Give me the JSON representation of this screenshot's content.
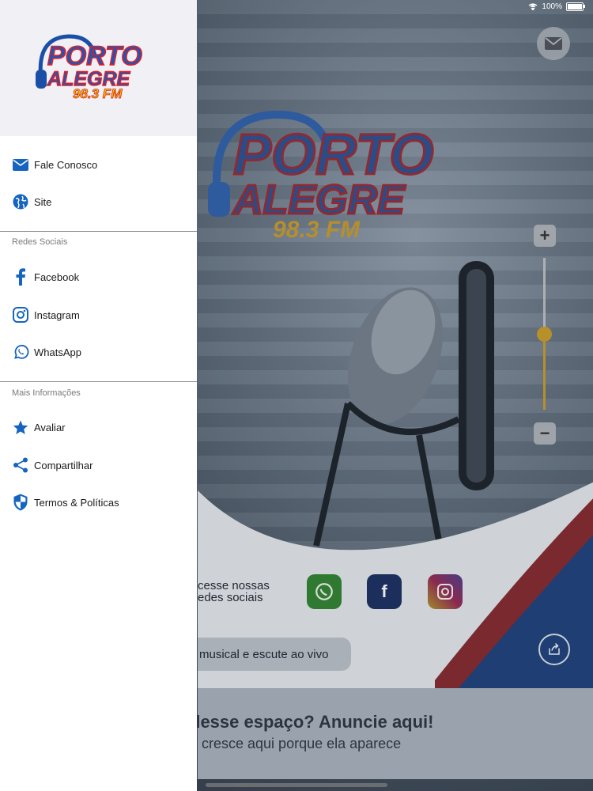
{
  "status_bar": {
    "battery": "100%",
    "battery_level": 1.0
  },
  "drawer": {
    "logo": {
      "line1": "PORTO",
      "line2": "ALEGRE",
      "freq": "98.3 FM"
    },
    "items_top": [
      {
        "label": "Fale Conosco",
        "icon": "mail-icon"
      },
      {
        "label": "Site",
        "icon": "globe-icon"
      }
    ],
    "section_social": "Redes Sociais",
    "items_social": [
      {
        "label": "Facebook",
        "icon": "facebook-icon"
      },
      {
        "label": "Instagram",
        "icon": "instagram-icon"
      },
      {
        "label": "WhatsApp",
        "icon": "whatsapp-icon"
      }
    ],
    "section_more": "Mais Informações",
    "items_more": [
      {
        "label": "Avaliar",
        "icon": "star-icon"
      },
      {
        "label": "Compartilhar",
        "icon": "share-icon"
      },
      {
        "label": "Termos & Políticas",
        "icon": "shield-icon"
      }
    ],
    "accent_color": "#1565c0"
  },
  "background": {
    "social_text_line1": "cesse nossas",
    "social_text_line2": "edes sociais",
    "pill_text": "musical e escute ao vivo",
    "banner_line1": "desse espaço? Anuncie aqui!",
    "banner_line2": "a cresce aqui porque ela aparece",
    "volume_level": 0.5,
    "zoom_plus": "+",
    "zoom_minus": "−"
  }
}
